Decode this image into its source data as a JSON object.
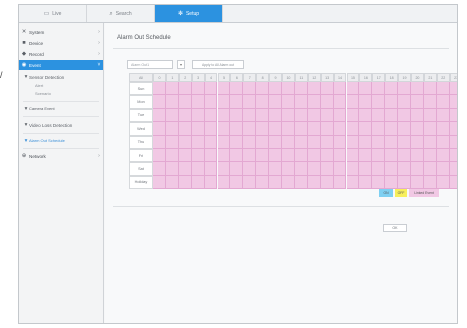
{
  "tabs": [
    {
      "label": "Live",
      "icon": "monitor-icon"
    },
    {
      "label": "Search",
      "icon": "search-icon"
    },
    {
      "label": "Setup",
      "icon": "gear-icon"
    }
  ],
  "sidebar": {
    "items": [
      {
        "label": "System",
        "icon": "tools-icon"
      },
      {
        "label": "Device",
        "icon": "camera-icon"
      },
      {
        "label": "Record",
        "icon": "record-icon"
      },
      {
        "label": "Event",
        "icon": "event-icon"
      }
    ],
    "event_children": {
      "sensor_detection": "Sensor Detection",
      "sensor_sub": [
        "Alert",
        "Scenario"
      ],
      "camera_event": "Camera Event",
      "video_loss": "Video Loss Detection",
      "alarm_schedule": "Alarm Out Schedule"
    },
    "network": {
      "label": "Network",
      "icon": "network-icon"
    }
  },
  "content": {
    "title": "Alarm Out Schedule",
    "select_placeholder": "Alarm Out1",
    "apply_label": "Apply to All Alarm out",
    "all_label": "All",
    "hours": [
      "0",
      "1",
      "2",
      "3",
      "4",
      "5",
      "6",
      "7",
      "8",
      "9",
      "10",
      "11",
      "12",
      "13",
      "14",
      "15",
      "16",
      "17",
      "18",
      "19",
      "20",
      "21",
      "22",
      "23"
    ],
    "days": [
      "Sun",
      "Mon",
      "Tue",
      "Wed",
      "Thu",
      "Fri",
      "Sat",
      "Holiday"
    ],
    "legend": [
      {
        "label": "ON",
        "color": "#7fd0f2"
      },
      {
        "label": "OFF",
        "color": "#f7ef5c"
      },
      {
        "label": "Linked Event",
        "color": "#f1c8e4"
      }
    ],
    "ok_label": "OK"
  }
}
